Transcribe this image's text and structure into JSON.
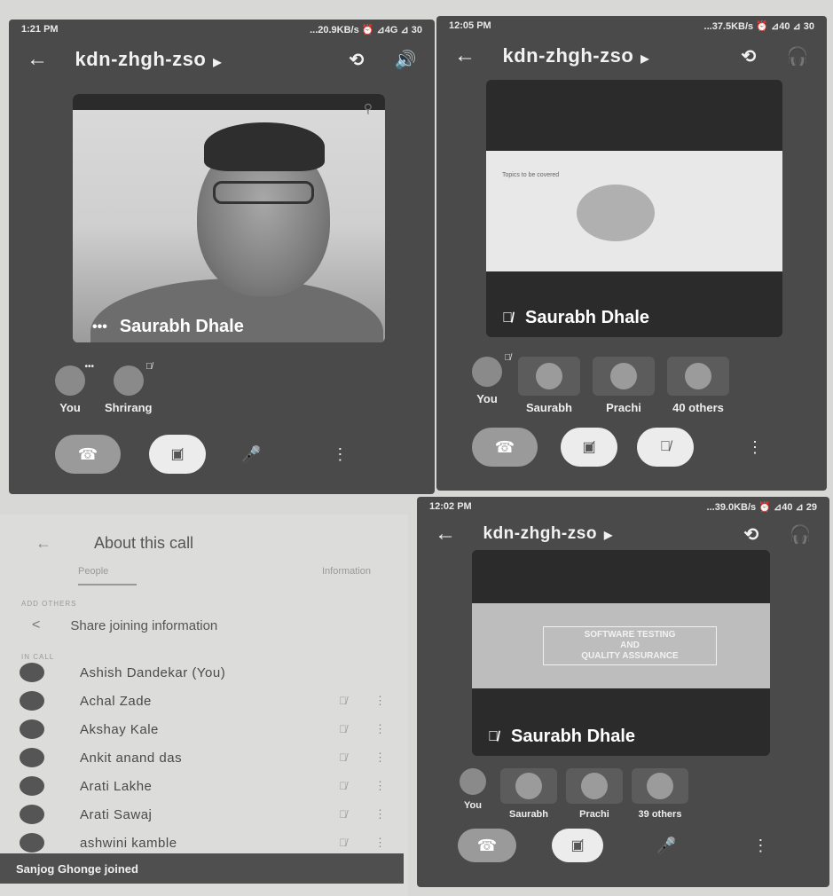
{
  "screen1": {
    "status": {
      "time": "1:21 PM",
      "right": "...20.9KB/s ⏰ ⊿4G ⊿ 30"
    },
    "title": "kdn-zhgh-zso",
    "main_speaker": "Saurabh Dhale",
    "participants": [
      {
        "label": "You"
      },
      {
        "label": "Shrirang"
      }
    ]
  },
  "screen2": {
    "status": {
      "time": "12:05 PM",
      "right": "...37.5KB/s ⏰ ⊿40 ⊿ 30"
    },
    "title": "kdn-zhgh-zso",
    "main_speaker": "Saurabh Dhale",
    "slide_heading": "Topics to be covered",
    "participants": [
      {
        "label": "You"
      },
      {
        "label": "Saurabh"
      },
      {
        "label": "Prachi"
      },
      {
        "label": "40 others"
      }
    ]
  },
  "screen3": {
    "status": {
      "time": "12:02 PM",
      "right": "...39.0KB/s ⏰ ⊿40 ⊿ 29"
    },
    "title": "kdn-zhgh-zso",
    "main_speaker": "Saurabh Dhale",
    "slide_title": [
      "SOFTWARE TESTING",
      "AND",
      "QUALITY ASSURANCE"
    ],
    "participants": [
      {
        "label": "You"
      },
      {
        "label": "Saurabh"
      },
      {
        "label": "Prachi"
      },
      {
        "label": "39 others"
      }
    ]
  },
  "about": {
    "title": "About this call",
    "tabs": [
      "People",
      "Information"
    ],
    "section_add": "ADD OTHERS",
    "share_label": "Share joining information",
    "section_incall": "IN CALL",
    "people": [
      "Ashish Dandekar (You)",
      "Achal Zade",
      "Akshay Kale",
      "Ankit anand das",
      "Arati Lakhe",
      "Arati Sawaj",
      "ashwini kamble"
    ],
    "toast": "Sanjog Ghonge joined"
  },
  "colors": {
    "phone_bg": "#4a4a4a",
    "end_call": "#9a9a9a",
    "panel_bg": "#dcdcda"
  },
  "icons": [
    "back-arrow-icon",
    "switch-camera-icon",
    "speaker-icon",
    "headphones-icon",
    "end-call-icon",
    "camera-off-icon",
    "mic-icon",
    "mic-off-icon",
    "more-icon",
    "share-icon",
    "pin-icon"
  ]
}
